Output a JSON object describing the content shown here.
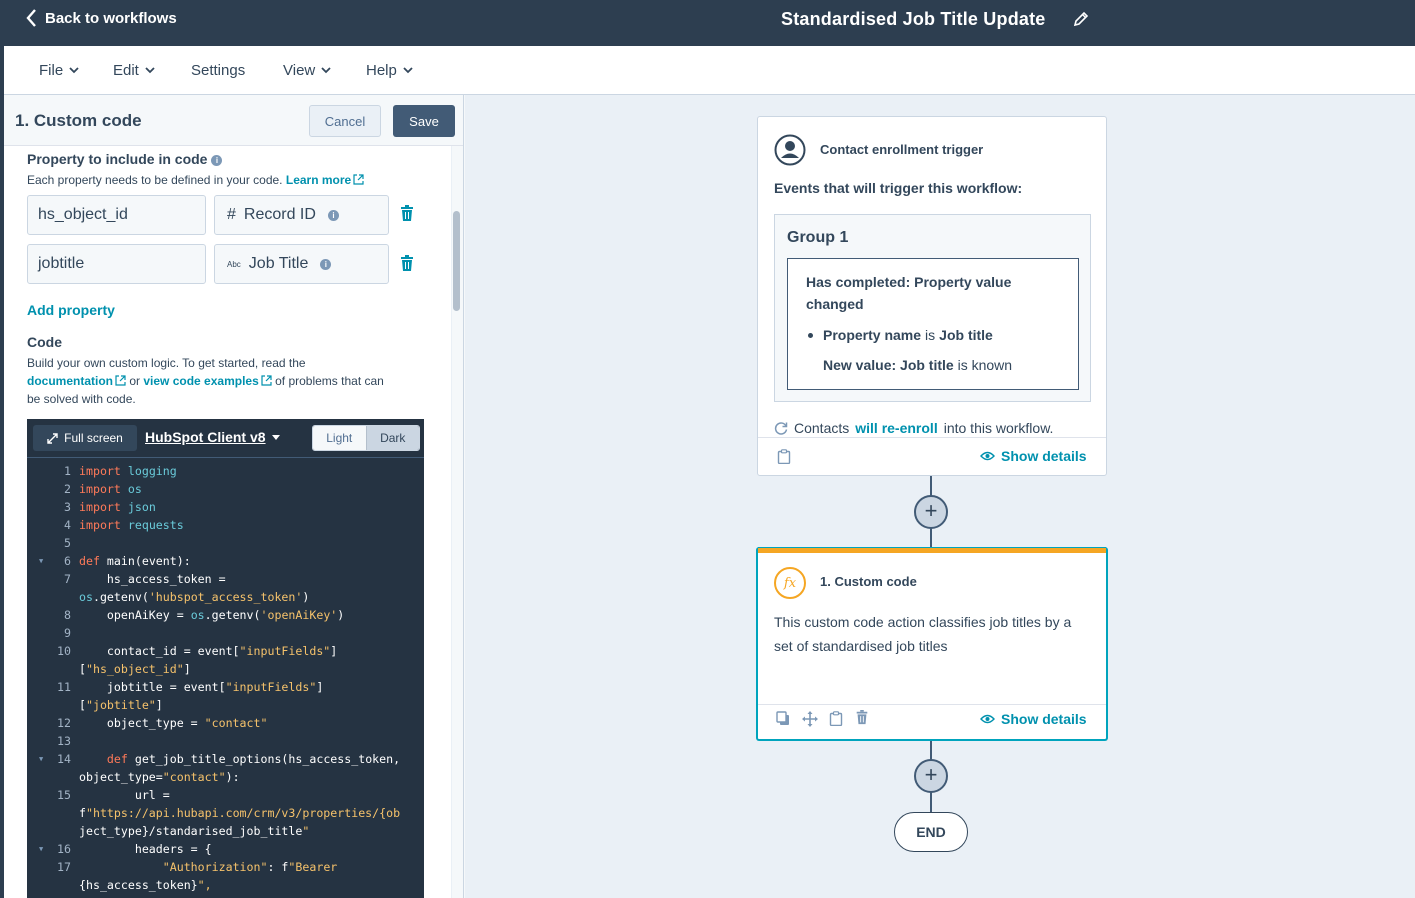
{
  "topbar": {
    "back_label": "Back to workflows",
    "workflow_title": "Standardised Job Title Update"
  },
  "menu": {
    "file": "File",
    "edit": "Edit",
    "settings": "Settings",
    "view": "View",
    "help": "Help"
  },
  "panel": {
    "title": "1. Custom code",
    "cancel_label": "Cancel",
    "save_label": "Save",
    "property_label": "Property to include in code",
    "property_help": "Each property needs to be defined in your code.",
    "learn_more": "Learn more",
    "properties": [
      {
        "name": "hs_object_id",
        "type_icon": "#",
        "value": "Record ID"
      },
      {
        "name": "jobtitle",
        "type_icon": "Abc",
        "value": "Job Title"
      }
    ],
    "add_property": "Add property",
    "code_label": "Code",
    "code_help_1": "Build your own custom logic. To get started, read the",
    "documentation_link": "documentation",
    "or_text": "or",
    "examples_link": "view code examples",
    "code_help_2": "of problems that can",
    "code_help_3": "be solved with code."
  },
  "editor": {
    "fullscreen_label": "Full screen",
    "client_label": "HubSpot Client v8",
    "light_label": "Light",
    "dark_label": "Dark",
    "lines": [
      {
        "n": "1",
        "t": "import logging"
      },
      {
        "n": "2",
        "t": "import os"
      },
      {
        "n": "3",
        "t": "import json"
      },
      {
        "n": "4",
        "t": "import requests"
      },
      {
        "n": "5",
        "t": ""
      },
      {
        "n": "6",
        "t": "def main(event):"
      },
      {
        "n": "7",
        "t": "    hs_access_token ="
      },
      {
        "n": "",
        "t": "os.getenv('hubspot_access_token')"
      },
      {
        "n": "8",
        "t": "    openAiKey = os.getenv('openAiKey')"
      },
      {
        "n": "9",
        "t": ""
      },
      {
        "n": "10",
        "t": "    contact_id = event[\"inputFields\"]"
      },
      {
        "n": "",
        "t": "[\"hs_object_id\"]"
      },
      {
        "n": "11",
        "t": "    jobtitle = event[\"inputFields\"]"
      },
      {
        "n": "",
        "t": "[\"jobtitle\"]"
      },
      {
        "n": "12",
        "t": "    object_type = \"contact\""
      },
      {
        "n": "13",
        "t": ""
      },
      {
        "n": "14",
        "t": "    def get_job_title_options(hs_access_token,"
      },
      {
        "n": "",
        "t": "object_type=\"contact\"):"
      },
      {
        "n": "15",
        "t": "        url ="
      },
      {
        "n": "",
        "t": "f\"https://api.hubapi.com/crm/v3/properties/{ob"
      },
      {
        "n": "",
        "t": "ject_type}/standarised_job_title\""
      },
      {
        "n": "16",
        "t": "        headers = {"
      },
      {
        "n": "17",
        "t": "            \"Authorization\": f\"Bearer"
      },
      {
        "n": "",
        "t": "{hs_access_token}\","
      }
    ],
    "fold_lines": [
      "6",
      "14",
      "16"
    ]
  },
  "trigger_card": {
    "title": "Contact enrollment trigger",
    "events_label": "Events that will trigger this workflow:",
    "group_title": "Group 1",
    "filter_title": "Has completed: Property value changed",
    "bullet_bold": "Property name",
    "bullet_is": "is",
    "bullet_value": "Job title",
    "new_value_bold": "New value: Job title",
    "new_value_rest": "is known",
    "reenroll_prefix": "Contacts",
    "reenroll_link": "will re-enroll",
    "reenroll_suffix": "into this workflow.",
    "show_details": "Show details"
  },
  "action_card": {
    "icon_text": "fx",
    "title": "1. Custom code",
    "description": "This custom code action classifies job titles by a set of standardised job titles",
    "show_details": "Show details"
  },
  "canvas": {
    "plus_label": "+",
    "end_label": "END"
  },
  "colors": {
    "topbar": "#2d3e50",
    "link": "#0091ae",
    "save_button": "#425b76",
    "action_accent": "#f5a623",
    "selected_border": "#00a4bd",
    "code_bg": "#253342"
  }
}
